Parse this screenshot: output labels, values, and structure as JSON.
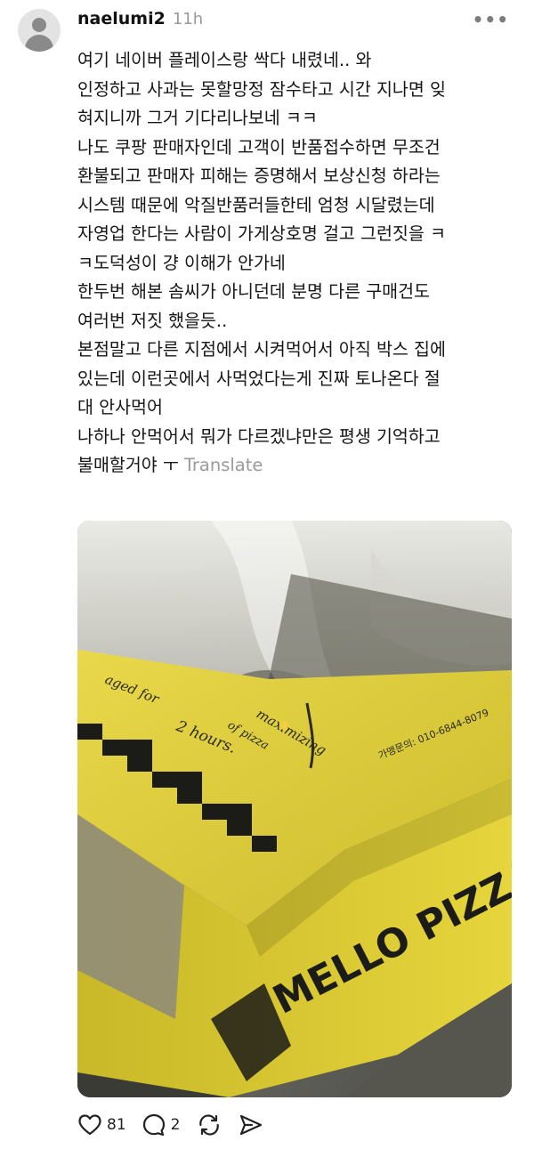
{
  "post": {
    "username": "naelumi2",
    "time": "11h",
    "lines": [
      "여기 네이버 플레이스랑 싹다 내렸네.. 와",
      "인정하고 사과는 못할망정 잠수타고 시간 지나면 잊",
      "혀지니까 그거 기다리나보네 ㅋㅋ",
      "나도 쿠팡 판매자인데 고객이 반품접수하면 무조건",
      "환불되고 판매자 피해는 증명해서 보상신청 하라는",
      "시스템 때문에 악질반품러들한테 엄청 시달렸는데",
      "자영업 한다는 사람이 가게상호명 걸고 그런짓을 ㅋ",
      "ㅋ도덕성이 걍 이해가 안가네",
      "한두번 해본 솜씨가 아니던데 분명 다른 구매건도",
      "여러번 저짓 했을듯..",
      "본점말고 다른 지점에서 시켜먹어서 아직 박스 집에",
      "있는데 이런곳에서 사먹었다는게 진짜 토나온다 절",
      "대 안사먹어",
      "나하나 안먹어서 뭐가 다르겠냐만은 평생 기억하고"
    ],
    "last_line": "불매할거야 ㅜ",
    "translate_label": "Translate"
  },
  "photo": {
    "box_text": {
      "aged": "aged for",
      "hours": "2 hours.",
      "maximizing": "maximizing",
      "of_pizza": "of pizza",
      "phone": "가맹문의: 010-6844-8079",
      "brand": "MELLO PIZZA"
    }
  },
  "actions": {
    "likes": "81",
    "comments": "2"
  },
  "icons": {
    "more": "more-options-icon",
    "like": "heart-icon",
    "comment": "comment-bubble-icon",
    "repost": "repost-icon",
    "share": "send-icon"
  },
  "colors": {
    "box_yellow": "#e4d23a",
    "text_gray": "#9a9a9a"
  }
}
